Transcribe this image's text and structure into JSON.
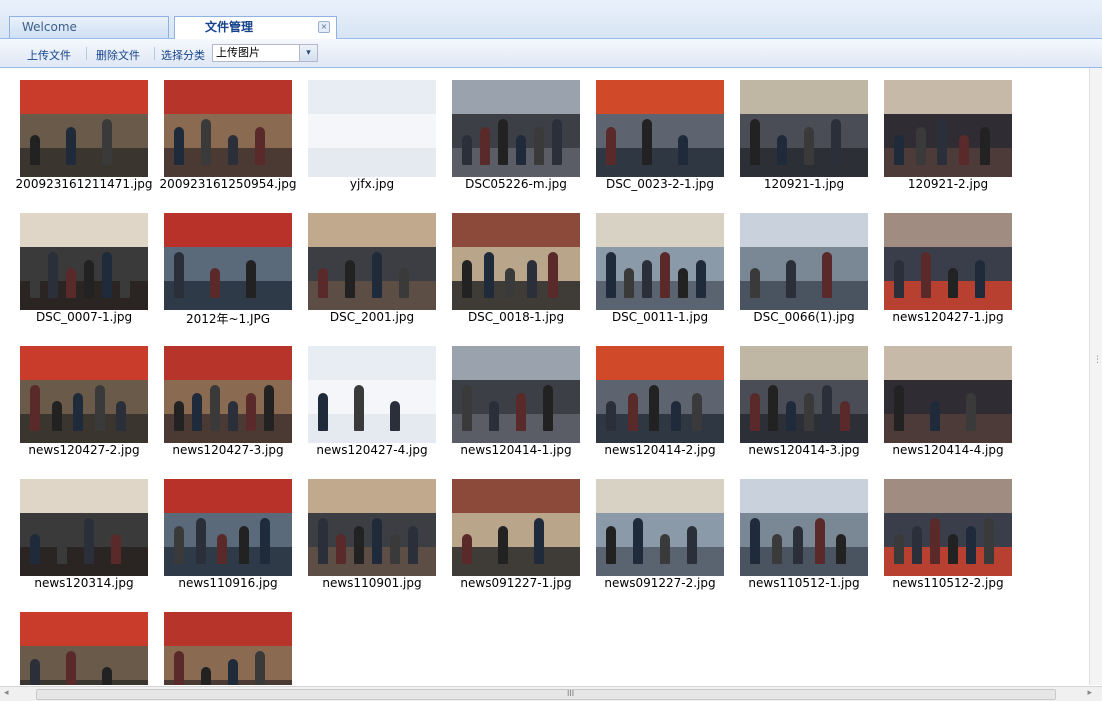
{
  "tabs": [
    {
      "label": "Welcome",
      "active": false
    },
    {
      "label": "文件管理",
      "active": true,
      "close_icon": "×"
    }
  ],
  "toolbar": {
    "upload_label": "上传文件",
    "delete_label": "删除文件",
    "category_label": "选择分类",
    "category_value": "上传图片",
    "dropdown_icon": "▾"
  },
  "files": [
    {
      "name": "200923161211471.jpg"
    },
    {
      "name": "200923161250954.jpg"
    },
    {
      "name": "yjfx.jpg"
    },
    {
      "name": "DSC05226-m.jpg"
    },
    {
      "name": "DSC_0023-2-1.jpg"
    },
    {
      "name": "120921-1.jpg"
    },
    {
      "name": "120921-2.jpg"
    },
    {
      "name": "DSC_0007-1.jpg"
    },
    {
      "name": "2012年~1.JPG"
    },
    {
      "name": "DSC_2001.jpg"
    },
    {
      "name": "DSC_0018-1.jpg"
    },
    {
      "name": "DSC_0011-1.jpg"
    },
    {
      "name": "DSC_0066(1).jpg"
    },
    {
      "name": "news120427-1.jpg"
    },
    {
      "name": "news120427-2.jpg"
    },
    {
      "name": "news120427-3.jpg"
    },
    {
      "name": "news120427-4.jpg"
    },
    {
      "name": "news120414-1.jpg"
    },
    {
      "name": "news120414-2.jpg"
    },
    {
      "name": "news120414-3.jpg"
    },
    {
      "name": "news120414-4.jpg"
    },
    {
      "name": "news120314.jpg"
    },
    {
      "name": "news110916.jpg"
    },
    {
      "name": "news110901.jpg"
    },
    {
      "name": "news091227-1.jpg"
    },
    {
      "name": "news091227-2.jpg"
    },
    {
      "name": "news110512-1.jpg"
    },
    {
      "name": "news110512-2.jpg"
    },
    {
      "name": ""
    },
    {
      "name": ""
    }
  ],
  "scrollbar": {
    "grip": "III"
  }
}
